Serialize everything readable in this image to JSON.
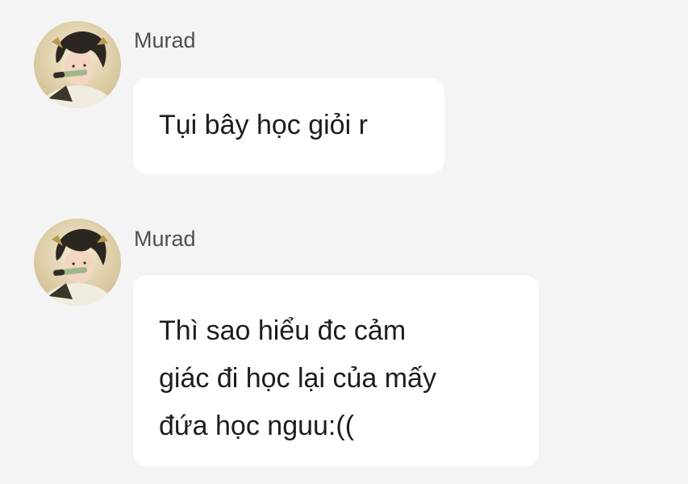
{
  "messages": [
    {
      "sender": "Murad",
      "avatar_icon": "user-avatar-icon",
      "text": "Tụi bây học giỏi r"
    },
    {
      "sender": "Murad",
      "avatar_icon": "user-avatar-icon",
      "text": "Thì sao hiểu đc cảm\ngiác đi học lại của mấy\nđứa học nguu:(("
    }
  ],
  "colors": {
    "background": "#f4f4f4",
    "bubble": "#ffffff",
    "sender_text": "#4f4f4f",
    "message_text": "#1d1d1d"
  }
}
